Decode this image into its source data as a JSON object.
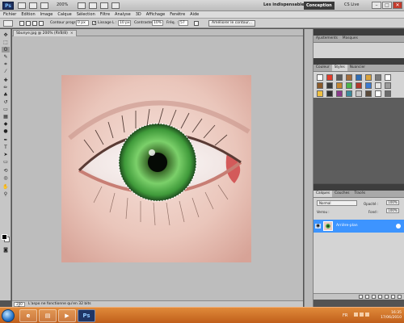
{
  "appbar": {
    "app_logo": "Ps",
    "zoom": "200%",
    "workspace_label": "Les indispensables",
    "workspace_active": "Conception",
    "workspace_chevron": "»",
    "cs_live": "CS Live",
    "controls": [
      "–",
      "□",
      "✕"
    ]
  },
  "menu": [
    "Fichier",
    "Edition",
    "Image",
    "Calque",
    "Sélection",
    "Filtre",
    "Analyse",
    "3D",
    "Affichage",
    "Fenêtre",
    "Aide"
  ],
  "options": {
    "contour_label": "Contour progr. :",
    "contour_value": "0 px",
    "lissage_label": "Lissage",
    "largeur_label": "L :",
    "largeur_value": "10 px",
    "contraste_label": "Contraste :",
    "contraste_value": "10%",
    "freq_label": "Fréq. :",
    "freq_value": "57",
    "refine_button": "Améliorer le contour..."
  },
  "document": {
    "tab_title": "Sbunye.jpg @ 200% (RVB/8)",
    "tab_close": "×",
    "zoom": "200 %",
    "status_message": "L'aspo ne fonctionne qu'en 32 bits"
  },
  "dock": {
    "top_tabs": [
      "Couleur",
      "Styles",
      "Nuancier"
    ],
    "top_active": 1,
    "layer_tabs": [
      "Calques",
      "Couches",
      "Tracés"
    ],
    "layer_active": 0,
    "blend_mode": "Normal",
    "opacity_label": "Opacité :",
    "opacity_value": "100%",
    "lock_label": "Verrou :",
    "fill_label": "Fond :",
    "fill_value": "100%",
    "layer_name": "Arrière-plan",
    "style_swatches": [
      "#ffffff",
      "#e23c2b",
      "#5b5b5b",
      "#a36b3a",
      "#2f6db5",
      "#d9a23b",
      "#7a7a7a",
      "#ffffff",
      "#8a5a2a",
      "#3a3a3a",
      "#c4862f",
      "#4db34a",
      "#b23a2a",
      "#3c7ad0",
      "#e6e6e6",
      "#9b9b9b",
      "#f0c040",
      "#2f2f2f",
      "#8a3a8a",
      "#3b8a9b",
      "#c7c7c7",
      "#5a4a3a",
      "#ffffff",
      "#6a6a6a"
    ]
  },
  "taskbar": {
    "lang": "FR",
    "time": "16:35",
    "date": "17/06/2010"
  },
  "colors": {
    "accent": "#3d94ff",
    "taskbar": "#d9782b",
    "iris": "#4fa84a"
  }
}
